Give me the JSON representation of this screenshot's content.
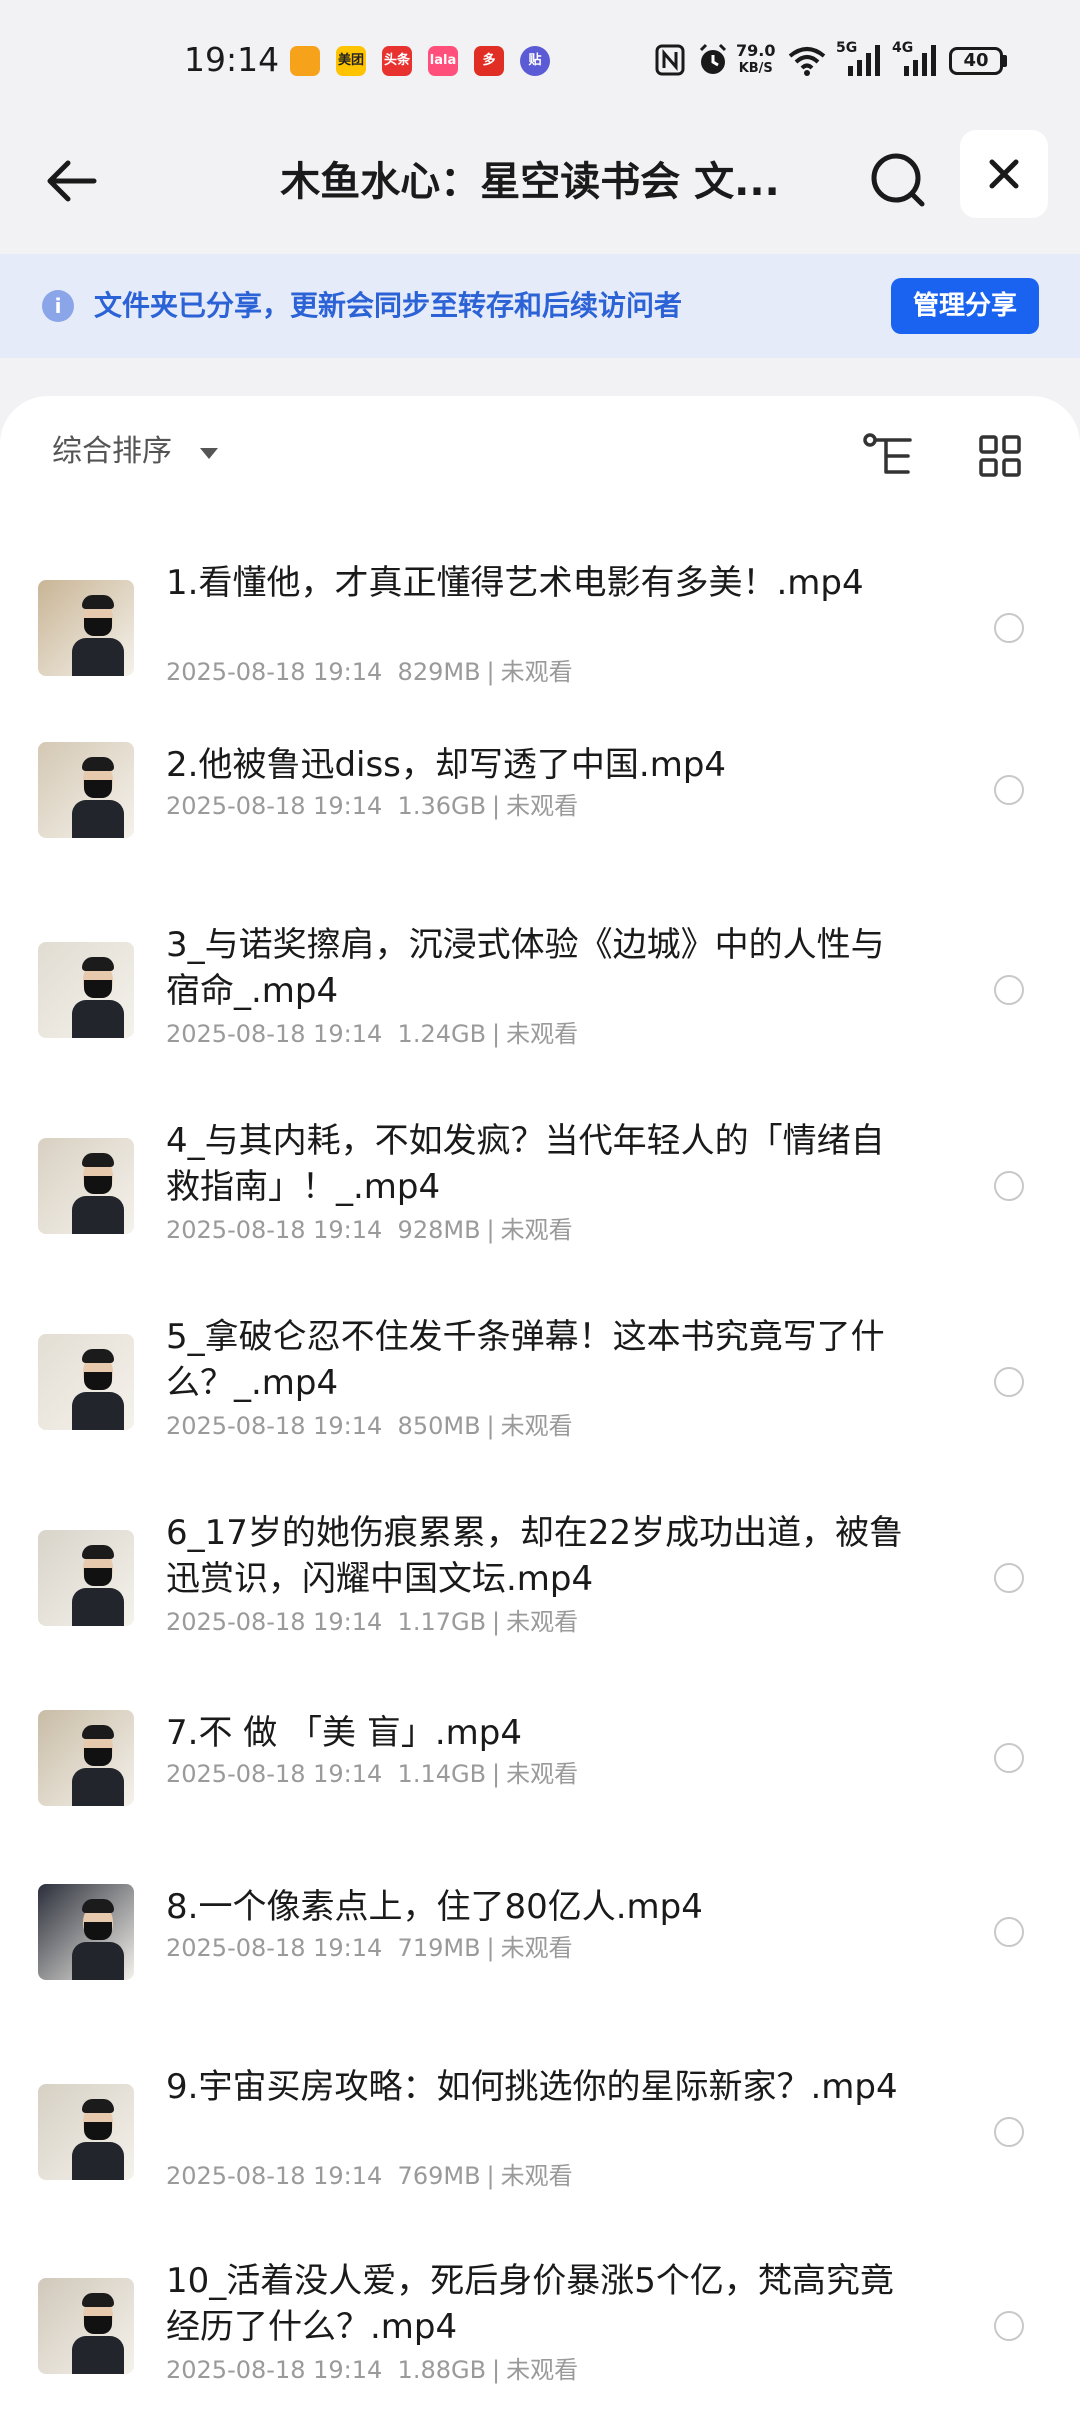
{
  "status_bar": {
    "time": "19:14",
    "app_icons": [
      {
        "name": "dingdong-icon",
        "label": "",
        "color": "#f7a21b"
      },
      {
        "name": "meituan-icon",
        "label": "美团",
        "color": "#ffc300"
      },
      {
        "name": "toutiao-icon",
        "label": "头条",
        "color": "#e8322f"
      },
      {
        "name": "xiaohongshu-lala-icon",
        "label": "lala",
        "color": "#ff4f7a"
      },
      {
        "name": "pinduoduo-icon",
        "label": "多",
        "color": "#e02e24"
      },
      {
        "name": "tieba-icon",
        "label": "贴",
        "color": "#5b5bd6"
      }
    ],
    "net_speed_value": "79.0",
    "net_speed_unit": "KB/S",
    "signal_5g": "5G",
    "signal_4g": "4G",
    "battery": "40"
  },
  "header": {
    "title": "木鱼水心：星空读书会 文..."
  },
  "banner": {
    "text": "文件夹已分享，更新会同步至转存和后续访问者",
    "button": "管理分享"
  },
  "sort": {
    "label": "综合排序"
  },
  "files": [
    {
      "name": "1.看懂他，才真正懂得艺术电影有多美！.mp4",
      "date": "2025-08-18 19:14",
      "size": "829MB",
      "status": "未观看"
    },
    {
      "name": "2.他被鲁迅diss，却写透了中国.mp4",
      "date": "2025-08-18 19:14",
      "size": "1.36GB",
      "status": "未观看"
    },
    {
      "name": "3_与诺奖擦肩，沉浸式体验《边城》中的人性与宿命_.mp4",
      "date": "2025-08-18 19:14",
      "size": "1.24GB",
      "status": "未观看"
    },
    {
      "name": "4_与其内耗，不如发疯？当代年轻人的「情绪自救指南」！_.mp4",
      "date": "2025-08-18 19:14",
      "size": "928MB",
      "status": "未观看"
    },
    {
      "name": "5_拿破仑忍不住发千条弹幕！这本书究竟写了什么？_.mp4",
      "date": "2025-08-18 19:14",
      "size": "850MB",
      "status": "未观看"
    },
    {
      "name": "6_17岁的她伤痕累累，却在22岁成功出道，被鲁迅赏识，闪耀中国文坛.mp4",
      "date": "2025-08-18 19:14",
      "size": "1.17GB",
      "status": "未观看"
    },
    {
      "name": "7.不 做 「美 盲」.mp4",
      "date": "2025-08-18 19:14",
      "size": "1.14GB",
      "status": "未观看"
    },
    {
      "name": "8.一个像素点上，住了80亿人.mp4",
      "date": "2025-08-18 19:14",
      "size": "719MB",
      "status": "未观看"
    },
    {
      "name": "9.宇宙买房攻略：如何挑选你的星际新家？.mp4",
      "date": "2025-08-18 19:14",
      "size": "769MB",
      "status": "未观看"
    },
    {
      "name": "10_活着没人爱，死后身价暴涨5个亿，梵高究竟经历了什么？.mp4",
      "date": "2025-08-18 19:14",
      "size": "1.88GB",
      "status": "未观看"
    }
  ],
  "meta_separator": "|"
}
